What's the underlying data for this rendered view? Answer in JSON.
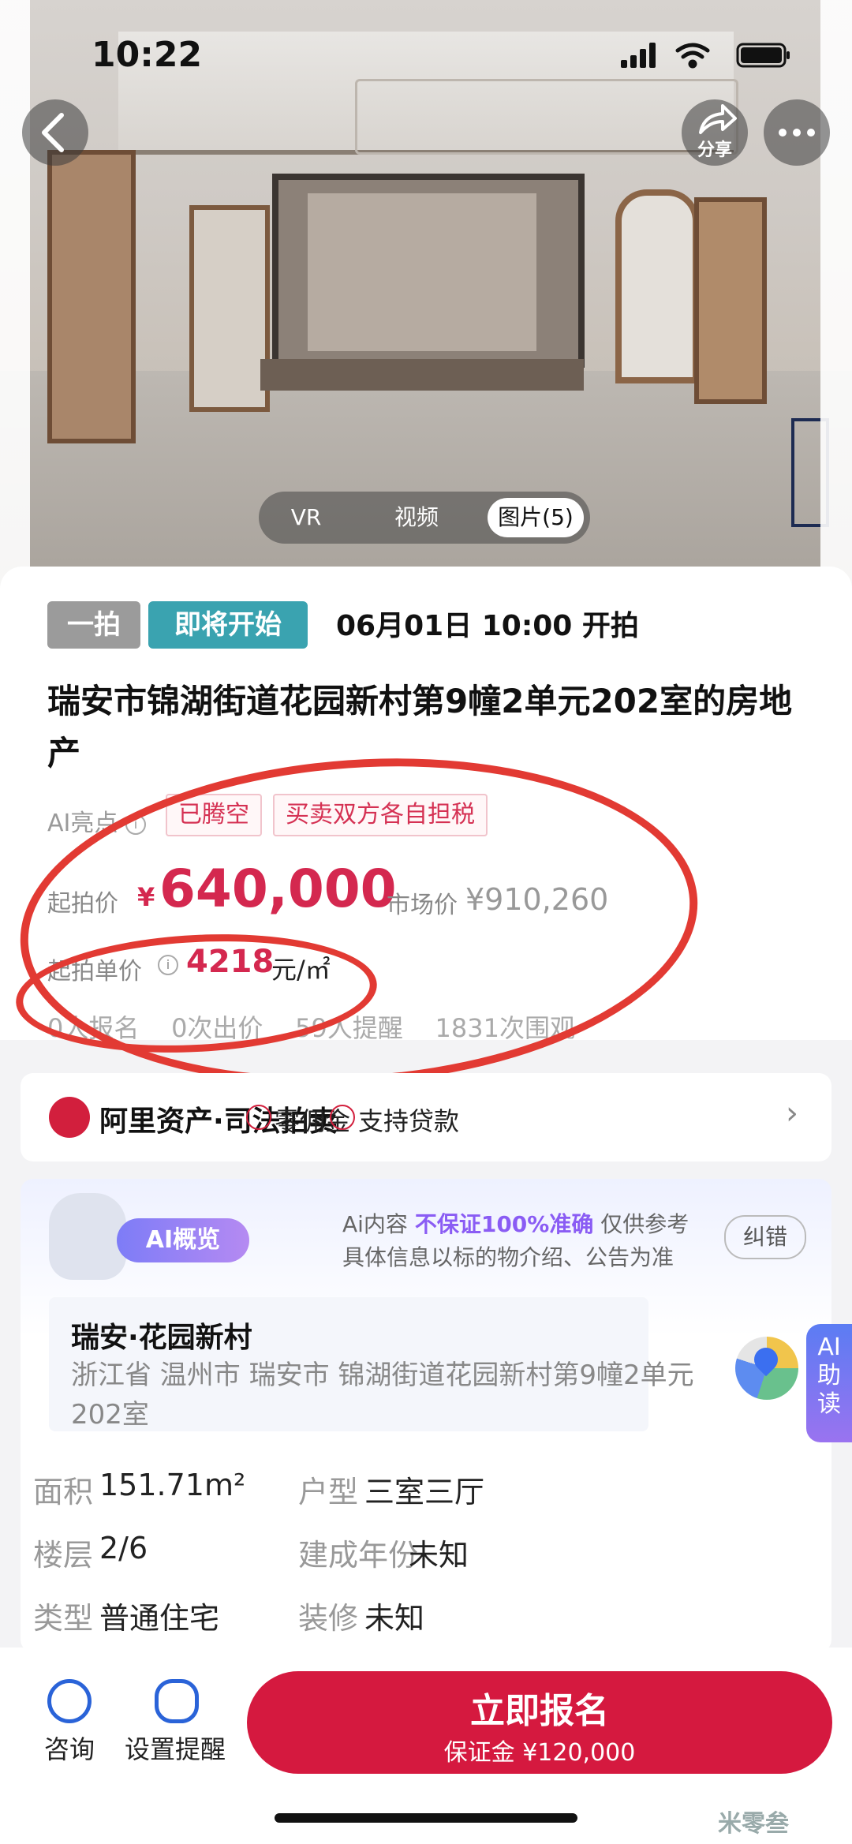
{
  "status": {
    "time": "10:22"
  },
  "header": {
    "share_label": "分享"
  },
  "media_tabs": [
    "VR",
    "视频",
    "图片(5)"
  ],
  "auction": {
    "round": "一拍",
    "state": "即将开始",
    "start_time": "06月01日 10:00 开拍",
    "title": "瑞安市锦湖街道花园新村第9幢2单元202室的房地产",
    "ai_highlight_label": "AI亮点",
    "tags": [
      "已腾空",
      "买卖双方各自担税"
    ],
    "start_price_label": "起拍价",
    "currency": "¥",
    "start_price": "640,000",
    "market_price_label": "市场价",
    "market_price": "¥910,260",
    "unit_price_label": "起拍单价",
    "unit_price": "4218",
    "unit_suffix": "元/㎡",
    "stats": [
      "0人报名",
      "0次出价",
      "59人提醒",
      "1831次围观"
    ]
  },
  "platform": {
    "name": "阿里资产·司法拍卖",
    "features": [
      "零佣金",
      "支持贷款"
    ]
  },
  "ai_overview": {
    "badge": "AI概览",
    "note_prefix": "Ai内容",
    "note_emph": "不保证100%准确",
    "note_suffix": "仅供参考",
    "note_line2": "具体信息以标的物介绍、公告为准",
    "correct_btn": "纠错",
    "community": "瑞安·花园新村",
    "address": "浙江省 温州市 瑞安市 锦湖街道花园新村第9幢2单元202室",
    "fields": [
      {
        "k": "面积",
        "v": "151.71m²"
      },
      {
        "k": "户型",
        "v": "三室三厅"
      },
      {
        "k": "楼层",
        "v": "2/6"
      },
      {
        "k": "建成年份",
        "v": "未知"
      },
      {
        "k": "类型",
        "v": "普通住宅"
      },
      {
        "k": "装修",
        "v": "未知"
      }
    ],
    "side_tab": "AI助读"
  },
  "bottom_bar": {
    "consult": "咨询",
    "remind": "设置提醒",
    "cta_main": "立即报名",
    "cta_sub": "保证金 ¥120,000"
  },
  "watermark": "米零叁",
  "colors": {
    "accent": "#d5193f",
    "price": "#d4284f",
    "teal": "#3aa3b0",
    "ai": "#8a5cf4"
  }
}
